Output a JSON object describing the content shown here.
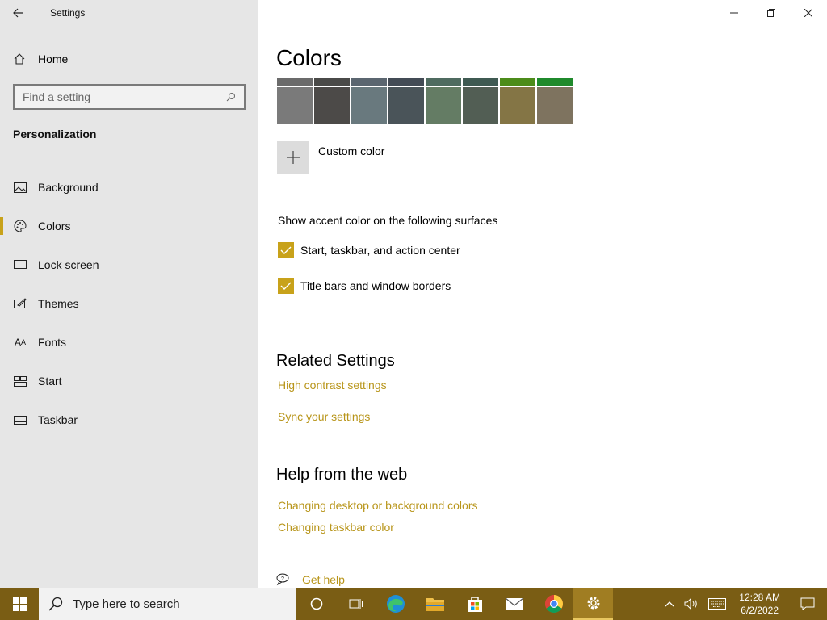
{
  "window": {
    "title": "Settings",
    "minimize_icon": "minimize-icon",
    "restore_icon": "restore-icon",
    "close_icon": "close-icon"
  },
  "sidebar": {
    "home_label": "Home",
    "search_placeholder": "Find a setting",
    "section_heading": "Personalization",
    "items": [
      {
        "label": "Background",
        "icon": "picture-icon"
      },
      {
        "label": "Colors",
        "icon": "palette-icon",
        "active": true
      },
      {
        "label": "Lock screen",
        "icon": "lock-screen-icon"
      },
      {
        "label": "Themes",
        "icon": "themes-icon"
      },
      {
        "label": "Fonts",
        "icon": "fonts-icon"
      },
      {
        "label": "Start",
        "icon": "start-icon"
      },
      {
        "label": "Taskbar",
        "icon": "taskbar-icon"
      }
    ]
  },
  "main": {
    "title": "Colors",
    "swatches": [
      {
        "top": "#6b6b6b",
        "bottom": "#7a7a7a"
      },
      {
        "top": "#4a4a48",
        "bottom": "#4c4a48"
      },
      {
        "top": "#5b6670",
        "bottom": "#69797e"
      },
      {
        "top": "#434b55",
        "bottom": "#4a5459"
      },
      {
        "top": "#4f6b60",
        "bottom": "#647c64"
      },
      {
        "top": "#3f5a52",
        "bottom": "#525e54"
      },
      {
        "top": "#4c8c1a",
        "bottom": "#847545"
      },
      {
        "top": "#1f8a2c",
        "bottom": "#7e735f"
      }
    ],
    "custom_color_label": "Custom color",
    "surfaces_label": "Show accent color on the following surfaces",
    "check_start_taskbar": "Start, taskbar, and action center",
    "check_title_bars": "Title bars and window borders",
    "related_heading": "Related Settings",
    "link_high_contrast": "High contrast settings",
    "link_sync": "Sync your settings",
    "help_heading": "Help from the web",
    "link_desktop_colors": "Changing desktop or background colors",
    "link_taskbar_color": "Changing taskbar color",
    "get_help": "Get help",
    "accent_color": "#c8a21a",
    "link_color": "#b8951a"
  },
  "taskbar": {
    "search_placeholder": "Type here to search",
    "time": "12:28 AM",
    "date": "6/2/2022",
    "background": "#7a5d14"
  }
}
